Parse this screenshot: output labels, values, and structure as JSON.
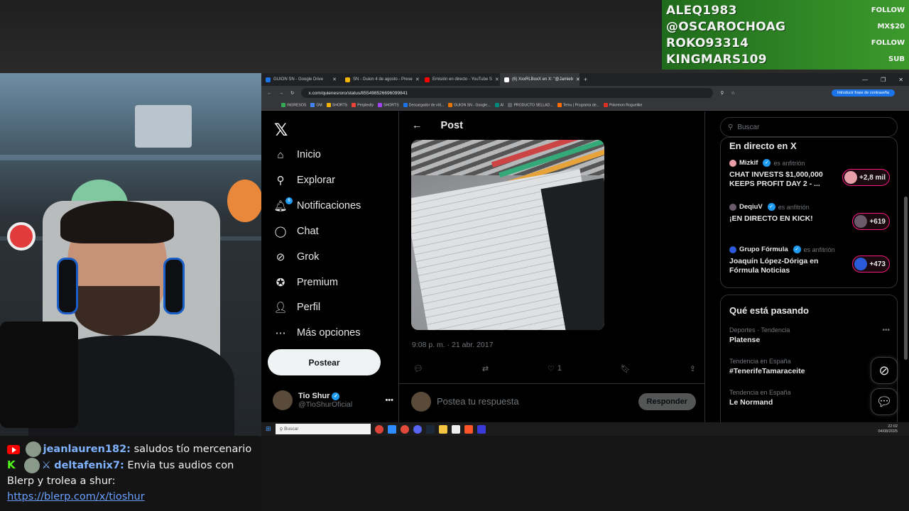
{
  "alerts": [
    {
      "name": "ALEQ1983",
      "type": "FOLLOW"
    },
    {
      "name": "@OSCAROCHOAG",
      "type": "MX$20"
    },
    {
      "name": "ROKO93314",
      "type": "FOLLOW"
    },
    {
      "name": "KINGMARS109",
      "type": "SUB"
    }
  ],
  "chat": [
    {
      "user": "jeanlauren182:",
      "message": " saludos tío mercenario",
      "platform": "youtube"
    },
    {
      "user": "deltafenix7:",
      "message": " Envia tus audios con",
      "platform": "kick"
    },
    {
      "message": "Blerp y trolea a shur:"
    },
    {
      "link": "https://blerp.com/x/tioshur"
    }
  ],
  "browser": {
    "tabs": [
      {
        "label": "GUION SN - Google Drive",
        "color": "#1a73e8"
      },
      {
        "label": "SN - Guion 4 de agosto - Prese",
        "color": "#f4b400"
      },
      {
        "label": "Emisión en directo - YouTube S",
        "color": "#ff0000"
      },
      {
        "label": "(6) XxxRLBoxX en X: \"@Jamieb",
        "color": "#ffffff"
      }
    ],
    "new_tab": "+",
    "url": "x.com/quienesroro/status/855498526696099841",
    "password_btn": "Introducir frase de contraseña",
    "bookmarks": [
      "INGRESOS",
      "GM",
      "SHORTS",
      "Perplexity",
      "SHORTS",
      "Descargador de víd...",
      "GUION SN - Google...",
      "AI",
      "PRODUCTO SELLAD...",
      "Temu | Programa de...",
      "Pokemon Roguelike"
    ]
  },
  "nav": {
    "items": [
      {
        "label": "Inicio",
        "icon": "home-icon",
        "glyph": "⌂"
      },
      {
        "label": "Explorar",
        "icon": "search-icon",
        "glyph": "⚲"
      },
      {
        "label": "Notificaciones",
        "icon": "bell-icon",
        "glyph": "🔔︎"
      },
      {
        "label": "Chat",
        "icon": "chat-icon",
        "glyph": "◯"
      },
      {
        "label": "Grok",
        "icon": "grok-icon",
        "glyph": "⊘"
      },
      {
        "label": "Premium",
        "icon": "premium-icon",
        "glyph": "✪"
      },
      {
        "label": "Perfil",
        "icon": "user-icon",
        "glyph": "👤︎"
      },
      {
        "label": "Más opciones",
        "icon": "more-icon",
        "glyph": "⋯"
      }
    ],
    "notif_count": "6",
    "post_button": "Postear",
    "profile": {
      "name": "Tio Shur",
      "handle": "@TioShurOficial"
    }
  },
  "post": {
    "header": "Post",
    "date": "9:08 p. m. · 21 abr. 2017",
    "likes": "1",
    "reply_placeholder": "Postea tu respuesta",
    "reply_button": "Responder"
  },
  "sidebar": {
    "search_placeholder": "Buscar",
    "partial_top": "...",
    "live_title": "En directo en X",
    "host_suffix": "es anfitrión",
    "live": [
      {
        "host": "Mizkif",
        "title": "CHAT INVESTS $1,000,000 KEEPS PROFIT DAY 2 - ...",
        "count": "+2,8 mil",
        "color": "#e8a0a8"
      },
      {
        "host": "DeqiuV",
        "title": "¡EN DIRECTO EN KICK!",
        "count": "+619",
        "color": "#6a5a6a"
      },
      {
        "host": "Grupo Fórmula",
        "title": "Joaquín López-Dóriga en Fórmula Noticias",
        "count": "+473",
        "color": "#2a5ad8"
      }
    ],
    "trends_title": "Qué está pasando",
    "trends": [
      {
        "meta": "Deportes · Tendencia",
        "name": "Platense"
      },
      {
        "meta": "Tendencia en España",
        "name": "#TenerifeTamaraceite"
      },
      {
        "meta": "Tendencia en España",
        "name": "Le Normand"
      }
    ]
  },
  "taskbar": {
    "search": "Buscar",
    "time": "22:02",
    "date": "04/08/2025"
  }
}
